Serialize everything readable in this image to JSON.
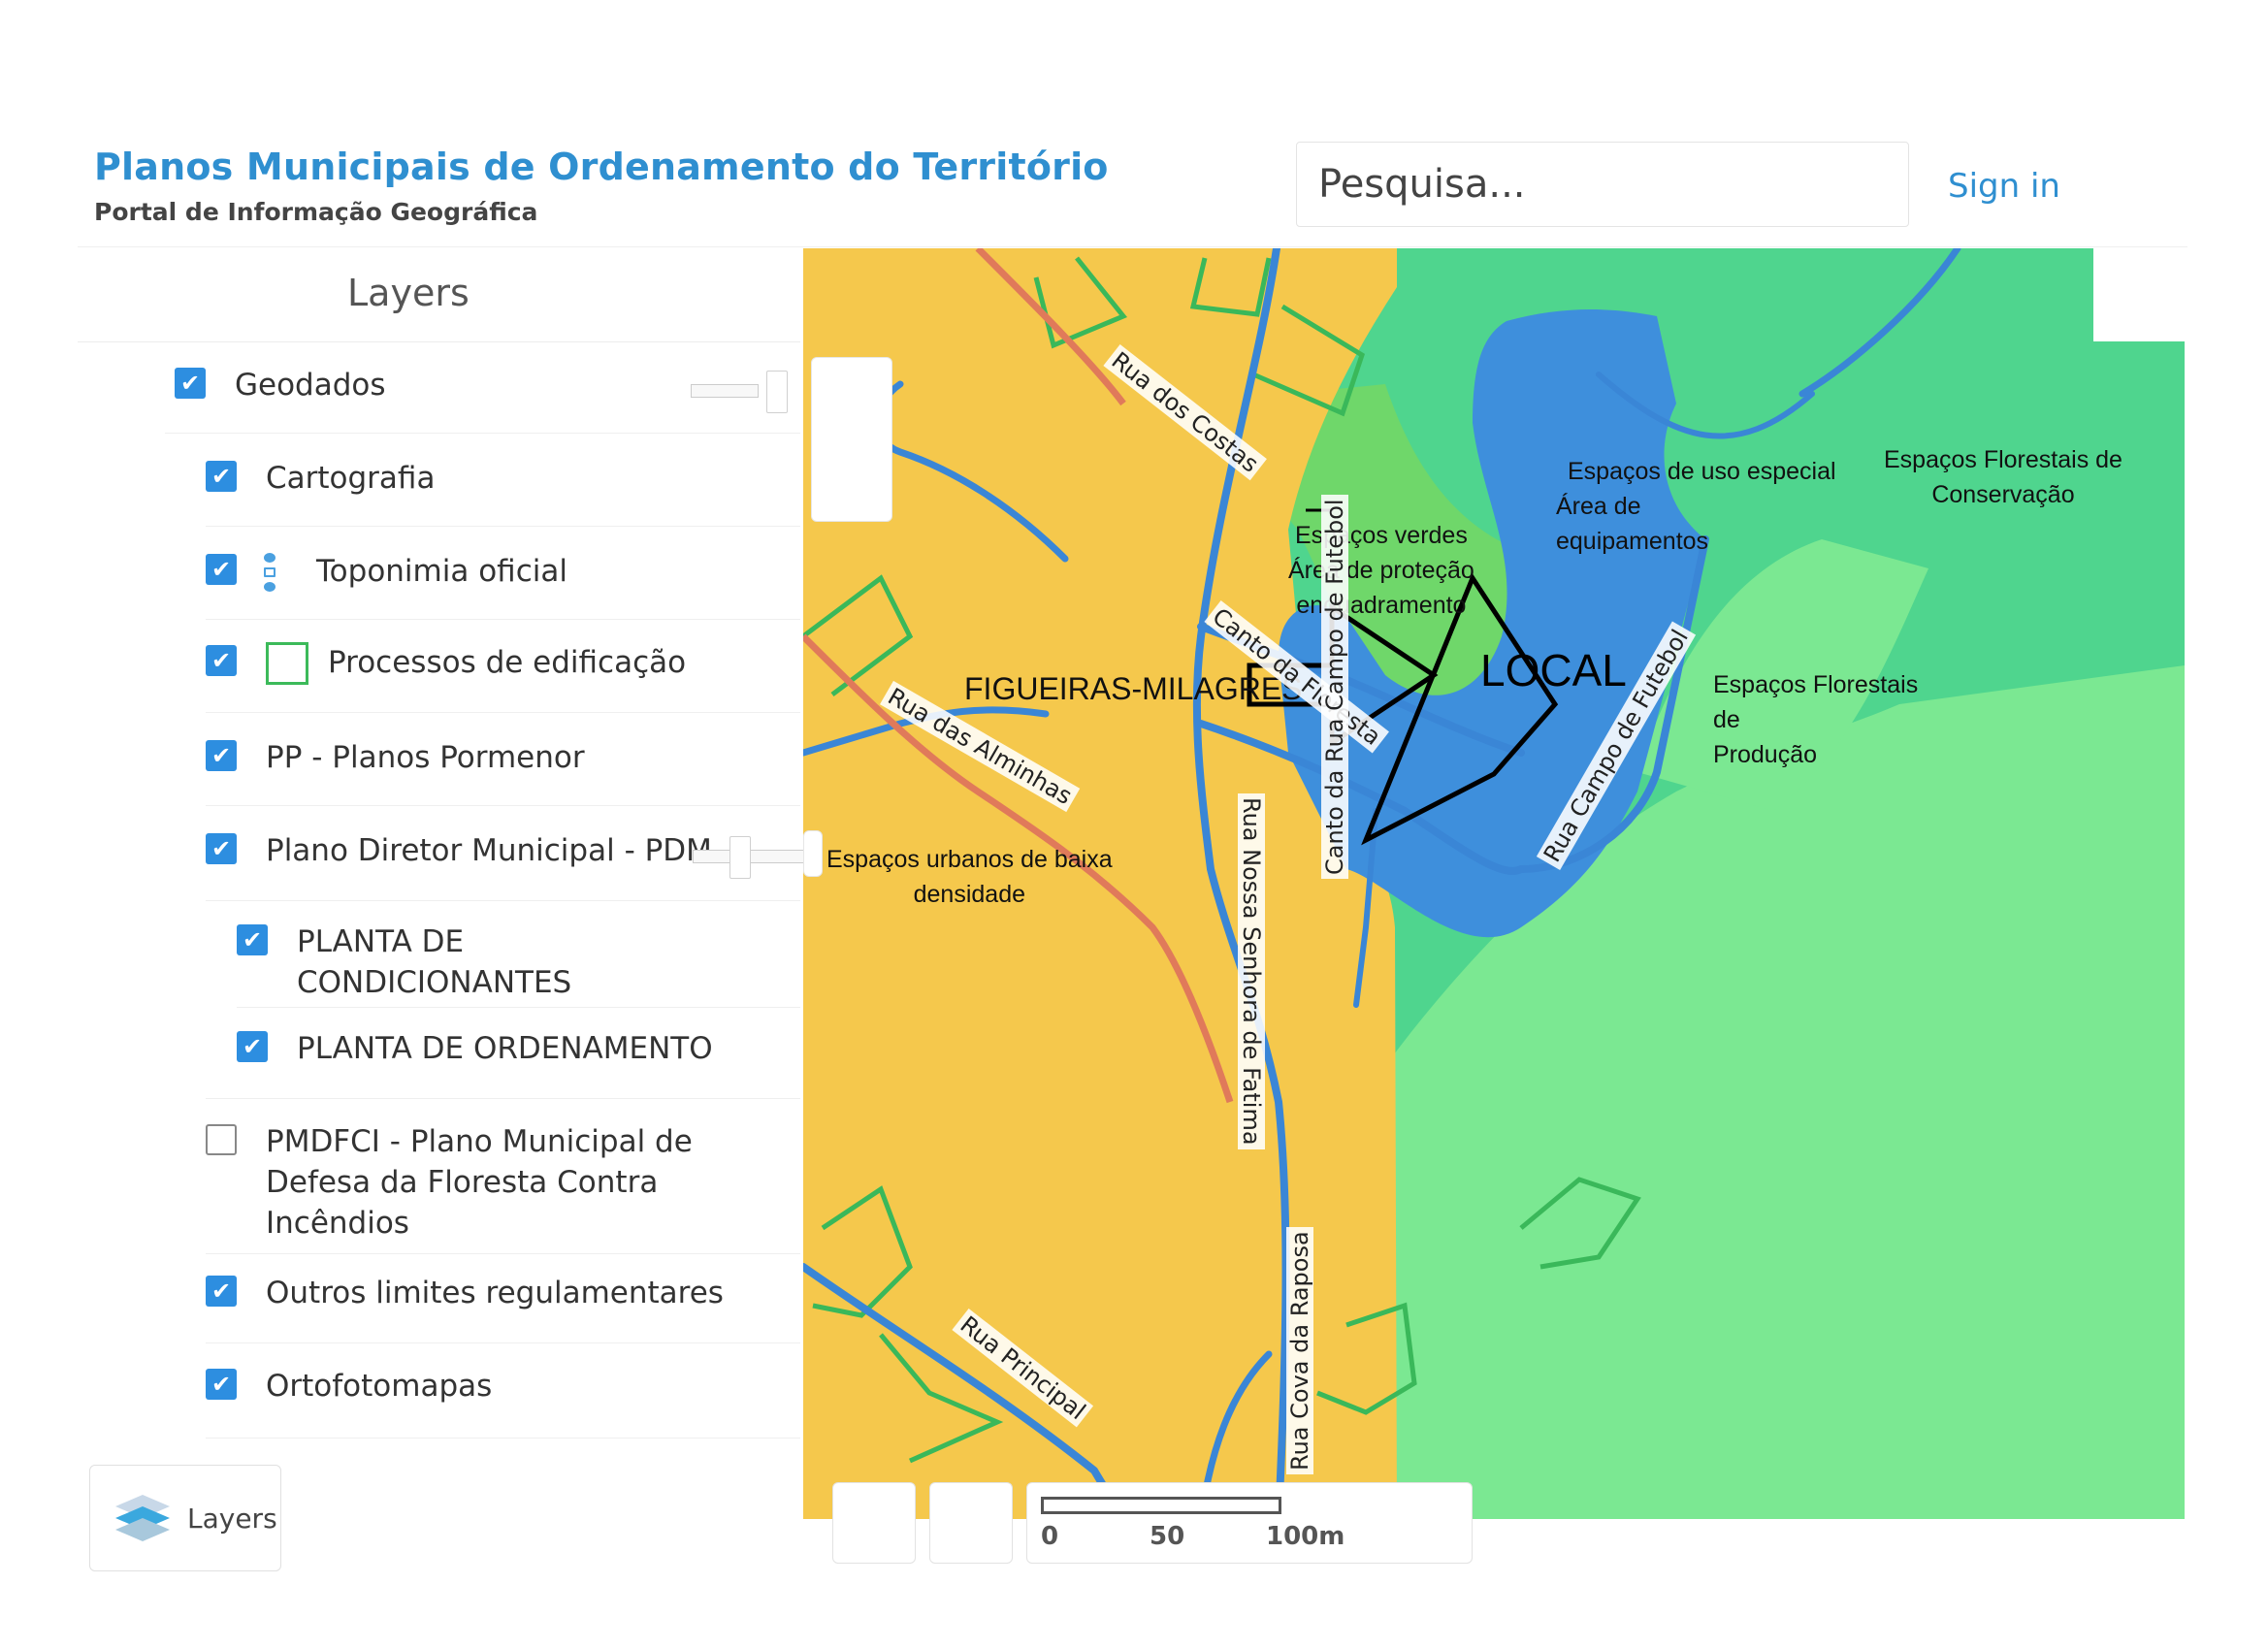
{
  "header": {
    "title": "Planos Municipais de Ordenamento do Território",
    "subtitle": "Portal de Informação Geográfica",
    "search_placeholder": "Pesquisa...",
    "sign_in": "Sign in"
  },
  "sidebar": {
    "title": "Layers",
    "layers": [
      {
        "label": "Geodados",
        "checked": true,
        "level": 0,
        "has_slider": true
      },
      {
        "label": "Cartografia",
        "checked": true,
        "level": 1
      },
      {
        "label": "Toponimia oficial",
        "checked": true,
        "level": 1,
        "legend_icon": "toponimia-legend-icon"
      },
      {
        "label": "Processos de edificação",
        "checked": true,
        "level": 1,
        "legend_icon": "green-outline-square-icon"
      },
      {
        "label": "PP - Planos Pormenor",
        "checked": true,
        "level": 1
      },
      {
        "label": "Plano Diretor Municipal - PDM",
        "checked": true,
        "level": 1,
        "has_slider": true
      },
      {
        "label": "PLANTA DE CONDICIONANTES",
        "checked": true,
        "level": 2
      },
      {
        "label": "PLANTA DE ORDENAMENTO",
        "checked": true,
        "level": 2
      },
      {
        "label": "PMDFCI - Plano Municipal de Defesa da Floresta Contra Incêndios",
        "checked": false,
        "level": 1
      },
      {
        "label": "Outros limites regulamentares",
        "checked": true,
        "level": 1
      },
      {
        "label": "Ortofotomapas",
        "checked": true,
        "level": 1
      }
    ],
    "layers_button": "Layers",
    "check_glyph": "✔"
  },
  "map": {
    "colors": {
      "urban": "#f5c84c",
      "forest_conservation": "#4fd58e",
      "forest_production": "#7be892",
      "green_spaces": "#6fd76a",
      "special_use": "#3e8fdc",
      "road": "#3a86d6",
      "main_road": "#e07a5a",
      "parcel": "#3ab85a"
    },
    "place_name": "FIGUEIRAS-MILAGRES",
    "local_marker": "LOCAL",
    "zone_labels": {
      "special_use": "Espaços de uso especial",
      "equipment": [
        "Área de",
        "equipamentos"
      ],
      "green_spaces": [
        "Espaços verdes",
        "Área de proteção",
        "enquadramento"
      ],
      "forest_conservation": [
        "Espaços Florestais de",
        "Conservação"
      ],
      "forest_production": [
        "Espaços Florestais",
        "de",
        "Produção"
      ],
      "urban_low_density": [
        "Espaços urbanos de baixa",
        "densidade"
      ]
    },
    "streets": [
      "Rua dos Costas",
      "Canto da Floresta",
      "Rua das Alminhas",
      "Rua Nossa Senhora de Fatima",
      "Canto da Rua Campo de Futebol",
      "Rua Campo de Futebol",
      "Rua Principal",
      "Rua Cova da Raposa"
    ],
    "scale": {
      "ticks": [
        "0",
        "50",
        "100m"
      ]
    }
  }
}
